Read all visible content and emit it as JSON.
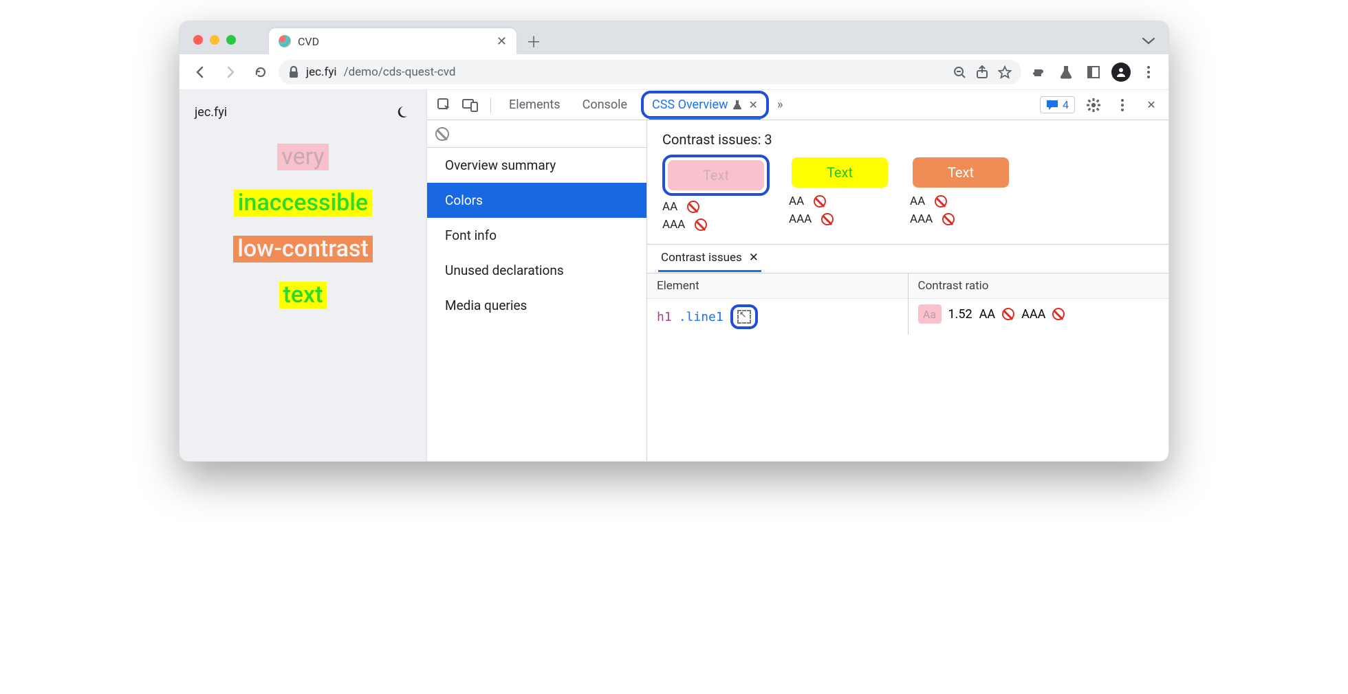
{
  "browser": {
    "tab_title": "CVD",
    "url_host": "jec.fyi",
    "url_path": "/demo/cds-quest-cvd"
  },
  "page": {
    "site_title": "jec.fyi",
    "lines": [
      "very",
      "inaccessible",
      "low-contrast",
      "text"
    ]
  },
  "devtools": {
    "tabs": {
      "elements": "Elements",
      "console": "Console",
      "css_overview": "CSS Overview"
    },
    "issues_count": "4",
    "sidebar": {
      "items": [
        "Overview summary",
        "Colors",
        "Font info",
        "Unused declarations",
        "Media queries"
      ],
      "active_index": 1
    },
    "overview": {
      "title_prefix": "Contrast issues: ",
      "count": "3",
      "swatch_label": "Text",
      "grades": {
        "aa": "AA",
        "aaa": "AAA"
      }
    },
    "bottom": {
      "tab_label": "Contrast issues",
      "col_element": "Element",
      "col_ratio": "Contrast ratio",
      "row": {
        "tag": "h1",
        "cls": ".line1",
        "chip": "Aa",
        "ratio": "1.52",
        "aa": "AA",
        "aaa": "AAA"
      }
    }
  }
}
